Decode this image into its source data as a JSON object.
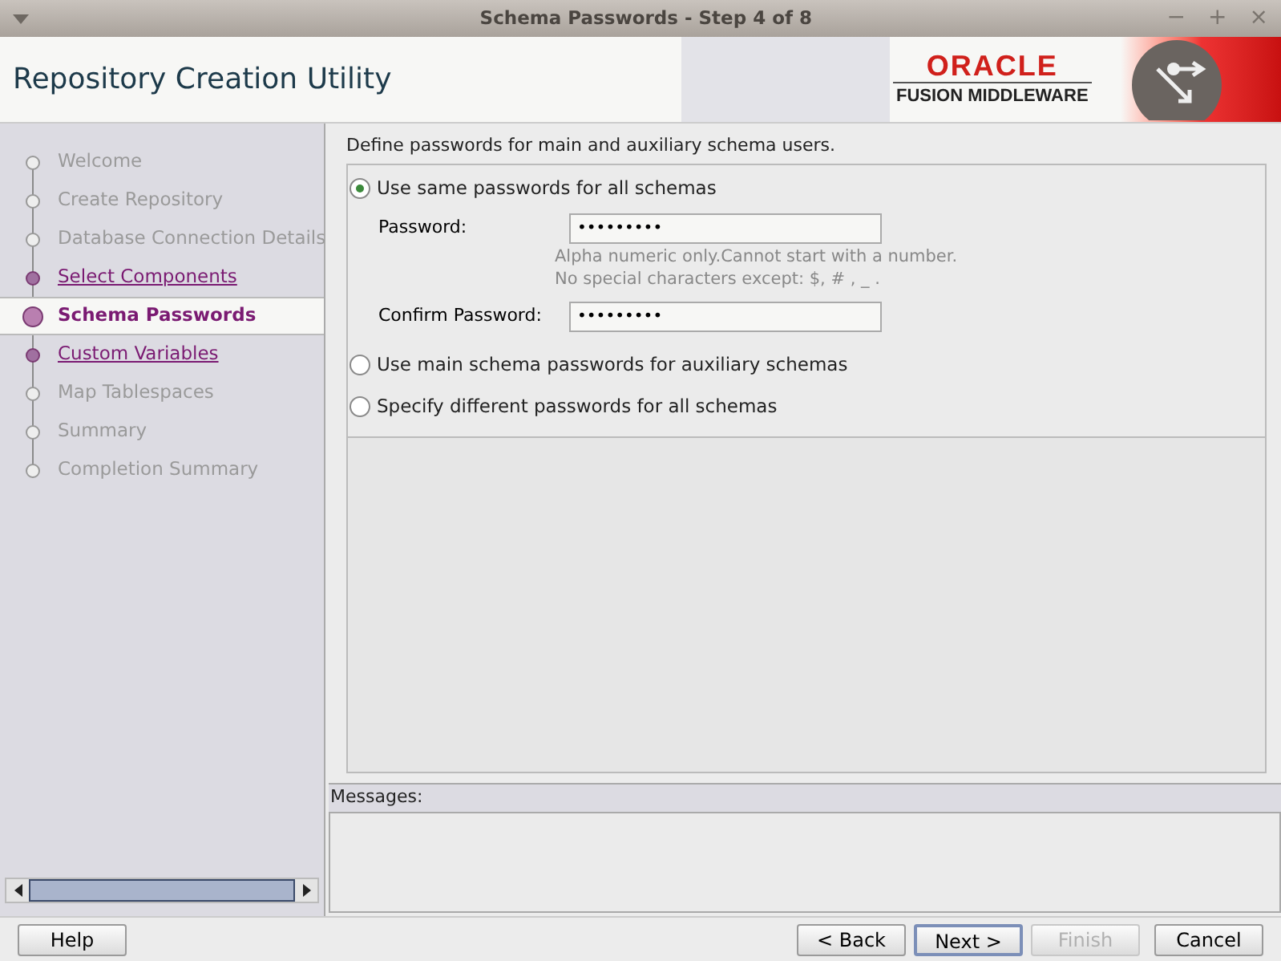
{
  "window": {
    "title": "Schema Passwords - Step 4 of 8",
    "controls": [
      "−",
      "+",
      "×"
    ]
  },
  "header": {
    "title": "Repository Creation Utility",
    "logo": {
      "brand": "ORACLE",
      "product": "FUSION MIDDLEWARE"
    }
  },
  "steps": [
    {
      "label": "Welcome",
      "kind": "disabled",
      "selected": false
    },
    {
      "label": "Create Repository",
      "kind": "disabled",
      "selected": false
    },
    {
      "label": "Database Connection Details",
      "kind": "disabled",
      "selected": false
    },
    {
      "label": "Select Components",
      "kind": "link",
      "selected": false
    },
    {
      "label": "Schema Passwords",
      "kind": "current",
      "selected": true
    },
    {
      "label": "Custom Variables",
      "kind": "link",
      "selected": false
    },
    {
      "label": "Map Tablespaces",
      "kind": "disabled",
      "selected": false
    },
    {
      "label": "Summary",
      "kind": "disabled",
      "selected": false
    },
    {
      "label": "Completion Summary",
      "kind": "disabled",
      "selected": false
    }
  ],
  "content": {
    "intro": "Define passwords for main and auxiliary schema users.",
    "options": [
      {
        "label": "Use same passwords for all schemas",
        "selected": true
      },
      {
        "label": "Use main schema passwords for auxiliary schemas",
        "selected": false
      },
      {
        "label": "Specify different passwords for all schemas",
        "selected": false
      }
    ],
    "password": {
      "label": "Password:",
      "value": "•••••••••"
    },
    "hint": [
      "Alpha numeric only.Cannot start with a number.",
      "No special characters except: $, # , _ ."
    ],
    "confirm": {
      "label": "Confirm Password:",
      "value": "•••••••••"
    }
  },
  "messages": {
    "label": "Messages:"
  },
  "buttons": [
    {
      "label": "Help",
      "disabled": false,
      "focused": false
    },
    {
      "label": "< Back",
      "disabled": false,
      "focused": false
    },
    {
      "label": "Next >",
      "disabled": false,
      "focused": true
    },
    {
      "label": "Finish",
      "disabled": true,
      "focused": false
    },
    {
      "label": "Cancel",
      "disabled": false,
      "focused": false
    }
  ]
}
